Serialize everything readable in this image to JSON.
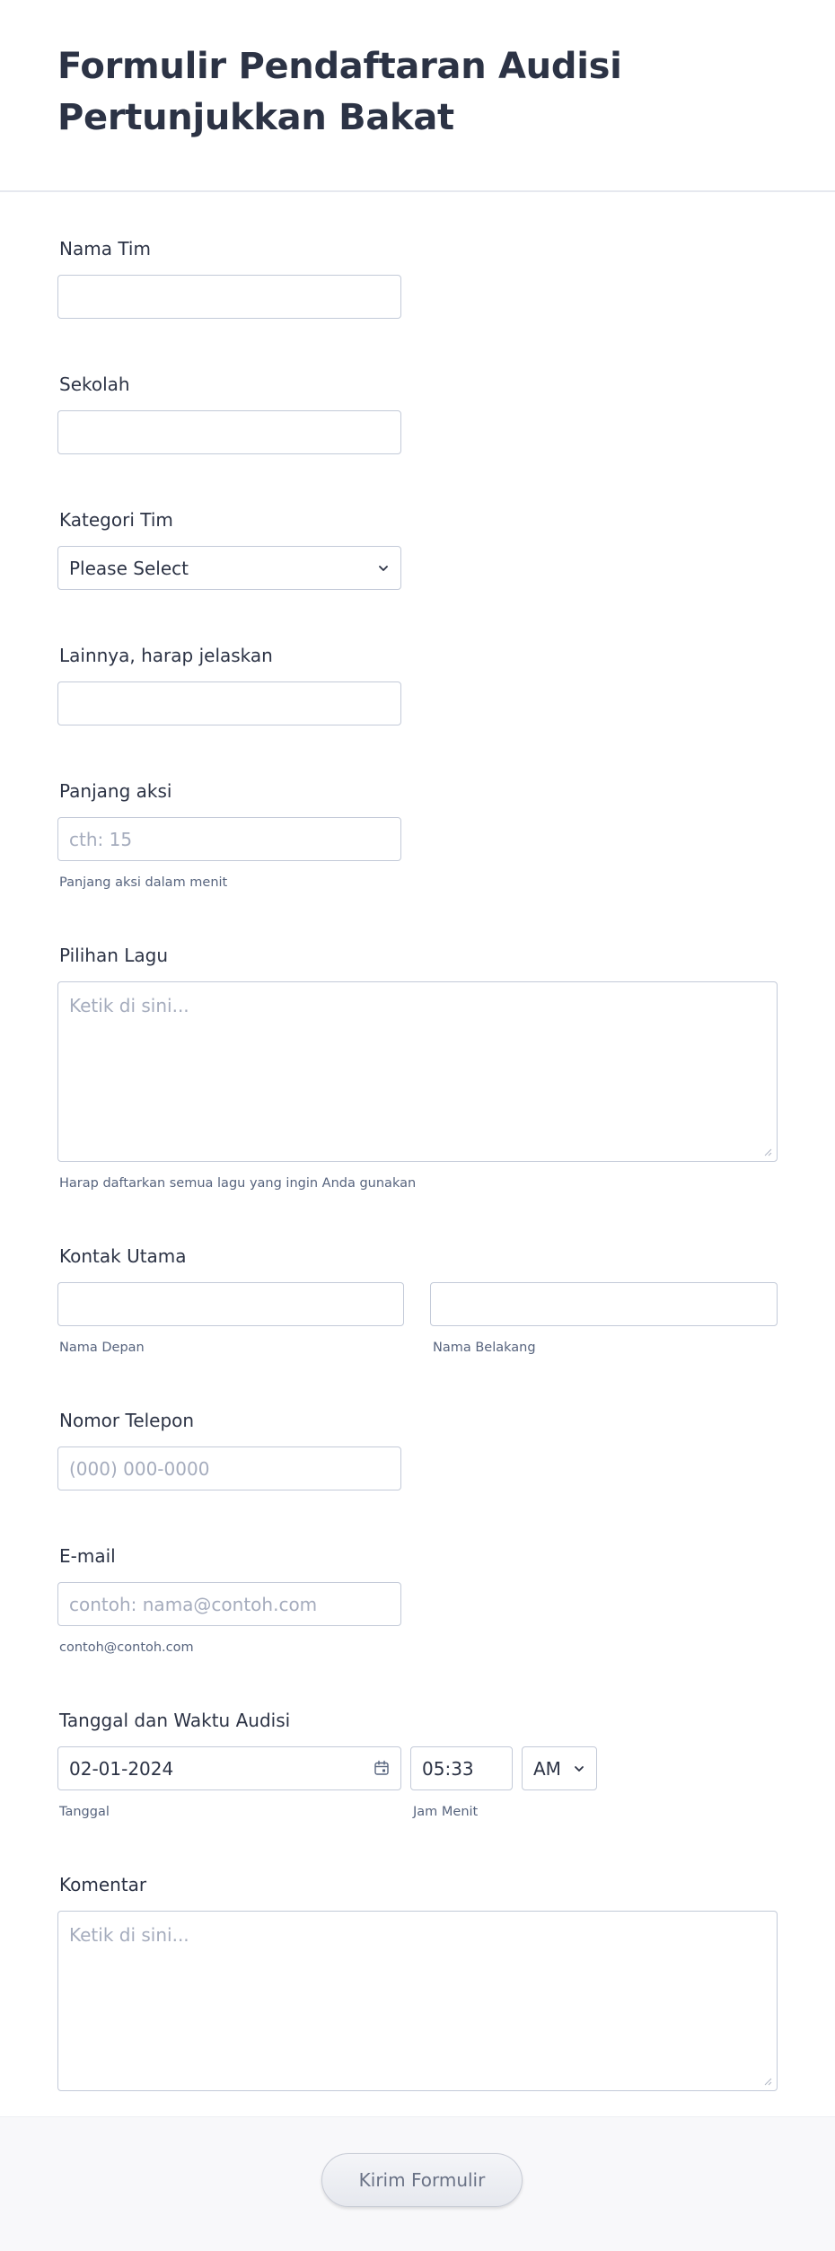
{
  "form": {
    "title": "Formulir Pendaftaran Audisi Pertunjukkan Bakat",
    "fields": {
      "team_name": {
        "label": "Nama Tim",
        "value": ""
      },
      "school": {
        "label": "Sekolah",
        "value": ""
      },
      "team_category": {
        "label": "Kategori Tim",
        "selected": "Please Select"
      },
      "other": {
        "label": "Lainnya, harap jelaskan",
        "value": ""
      },
      "act_length": {
        "label": "Panjang aksi",
        "placeholder": "cth: 15",
        "sublabel": "Panjang aksi dalam menit"
      },
      "song_choice": {
        "label": "Pilihan Lagu",
        "placeholder": "Ketik di sini...",
        "sublabel": "Harap daftarkan semua lagu yang ingin Anda gunakan"
      },
      "main_contact": {
        "label": "Kontak Utama",
        "first_sublabel": "Nama Depan",
        "last_sublabel": "Nama Belakang"
      },
      "phone": {
        "label": "Nomor Telepon",
        "placeholder": "(000) 000-0000"
      },
      "email": {
        "label": "E-mail",
        "placeholder": "contoh: nama@contoh.com",
        "sublabel": "contoh@contoh.com"
      },
      "audition_datetime": {
        "label": "Tanggal dan Waktu Audisi",
        "date_value": "02-01-2024",
        "time_value": "05:33",
        "ampm": "AM",
        "date_sublabel": "Tanggal",
        "time_sublabel": "Jam Menit"
      },
      "comments": {
        "label": "Komentar",
        "placeholder": "Ketik di sini..."
      }
    },
    "submit_label": "Kirim Formulir"
  }
}
